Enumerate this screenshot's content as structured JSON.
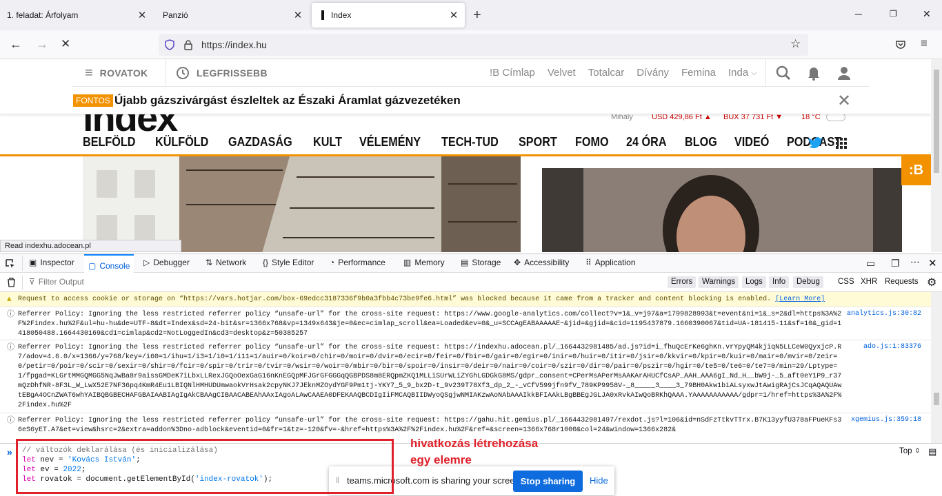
{
  "tabs": [
    {
      "title": "1. feladat: Árfolyam"
    },
    {
      "title": "Panzió"
    },
    {
      "title": "Index"
    }
  ],
  "nav": {
    "url": "https://index.hu"
  },
  "site": {
    "rovatok": "ROVATOK",
    "legfrissebb": "LEGFRISSEBB",
    "sites": [
      "!B Címlap",
      "Velvet",
      "Totalcar",
      "Dívány",
      "Femina",
      "Inda"
    ],
    "fontos_badge": "FONTOS",
    "headline": "Újabb gázszivárgást észleltek az Északi Áramlat gázvezetéken",
    "logo": "index",
    "ticker": {
      "name": "Mihály",
      "usd": "USD 429,86 Ft",
      "bux": "BUX 37 731 Ft",
      "temp": "18 °C"
    },
    "categories": [
      "BELFÖLD",
      "KÜLFÖLD",
      "GAZDASÁG",
      "KULT",
      "VÉLEMÉNY",
      "TECH-TUD",
      "SPORT",
      "FOMO",
      "24 ÓRA",
      "BLOG",
      "VIDEÓ",
      "PODCAST"
    ],
    "badge": ":B",
    "status": "Read indexhu.adocean.pl",
    "accent": "#f39200"
  },
  "devtools": {
    "tools": [
      "Inspector",
      "Console",
      "Debugger",
      "Network",
      "Style Editor",
      "Performance",
      "Memory",
      "Storage",
      "Accessibility",
      "Application"
    ],
    "filter_placeholder": "Filter Output",
    "levels": [
      "Errors",
      "Warnings",
      "Logs",
      "Info",
      "Debug"
    ],
    "extra": [
      "CSS",
      "XHR",
      "Requests"
    ],
    "messages": [
      {
        "type": "warning",
        "text": "Request to access cookie or storage on “https://vars.hotjar.com/box-69edcc3187336f9b0a3fbb4c73be9fe6.html” was blocked because it came from a tracker and content blocking is enabled.",
        "link": "[Learn More]",
        "source": ""
      },
      {
        "type": "info",
        "text": "Referrer Policy: Ignoring the less restricted referrer policy “unsafe-url” for the cross-site request: https://www.google-analytics.com/collect?v=1&_v=j97&a=1799828993&t=event&ni=1&_s=2&dl=https%3A%2F%2Findex.hu%2F&ul=hu-hu&de=UTF-8&dt=Index&sd=24-bit&sr=1366x768&vp=1349x643&je=0&ec=cimlap_scroll&ea=Loaded&ev=0&_u=SCCAgEABAAAAAE~&jid=&gjid=&cid=1195437879.1660390067&tid=UA-181415-11&sf=10&_gid=1418050488.1664430169&cd1=cimlap&cd2=NotLoggedIn&cd3=desktop&z=50385257",
        "source": "analytics.js:30:82"
      },
      {
        "type": "info",
        "text": "Referrer Policy: Ignoring the less restricted referrer policy “unsafe-url” for the cross-site request: https://indexhu.adocean.pl/_1664432981485/ad.js?id=i_fhuQcErKe6ghKn.vrYpyQM4kjiqN5LLCeW0QyxjcP.R7/adov=4.6.0/x=1366/y=768/key=/i60=1/ihu=1/i3=1/i0=1/i11=1/auir=0/koir=0/chir=0/moir=0/dvir=0/ecir=0/feir=0/fbir=0/gair=0/egir=0/inir=0/huir=0/itir=0/jsir=0/kkvir=0/kpir=0/kuir=0/mair=0/mvir=0/zeir=0/petir=0/poir=0/scir=0/sexir=0/shir=0/fcir=0/spir=0/trir=0/tvir=0/wsir=0/woir=0/mbir=0/bir=0/spoir=0/insir=0/deir=0/nair=0/coir=0/szir=0/dir=0/pair=0/pszir=0/hgir=0/te5=0/te6=0/te7=0/min=29/Lptype=1/fpgad=KLGrtMMGQMGG5NqJwBa8r9aissGMDeK7iLbxLLRexJGQoOexGaG16nKnEGQpMFJGrGFGGGqQGBPDS8m8ERQpmZKQ1MLLiSUrWLiZYGhLGDGkG8MS/gdpr_consent=CPerMsAPerMsAAKArAHUCfCsAP_AAH_AAA6gI_Nd_H__bW9j-_5_aft0eY1P9_r37mQzDhfNR-8F3L_W_LwX52E7NF36pq4KmR4Eu1LBIQNlHMHUDUmwaokVrHsak2cpyNKJ7JEknMZOydYGF9Pm1tj-YKY7_5_9_bx2D-t_9v239T78Xf3_dp_2_-_vCfV599jfn9fV_789KP9958V-_8_____3____3_79BH0Akw1biALsyxwJtAwigRAjCsJCqAQAQUAwtEBgA4OCnZWAT6whYAIBQBGBECHAFGBAIAABIAgIgAkCBAAgCIBAACABEAhAAxIAgoALAwCAAEA0DFEKAAQBCDIgIiFMCAQBIIDWyoQSgjwNMIAKzwAoNAbAAAIkkBFIAAkLBgBBEgJGLJA0xRvkAIwQoBRKhQAAA.YAAAAAAAAAAA/gdpr=1/href=https%3A%2F%2Findex.hu%2F",
        "source": "ado.js:1:83376"
      },
      {
        "type": "info",
        "text": "Referrer Policy: Ignoring the less restricted referrer policy “unsafe-url” for the cross-site request: https://gahu.hit.gemius.pl/_1664432981497/rexdot.js?l=106&id=nSdFzTtkvTTrx.B7K13yyfU378aFPueKFs36eS6yET.A7&et=view&hsrc=2&extra=addon%3Dno-adblock&eventid=0&fr=1&tz=-120&fv=-&href=https%3A%2F%2Findex.hu%2F&ref=&screen=1366x768r1000&col=24&window=1366x282&",
        "source": "xgemius.js:359:18"
      }
    ],
    "input_lines": [
      {
        "comment": "// változók deklarálása (és inicializálása)"
      },
      {
        "kw": "let",
        "rest": " nev = ",
        "str": "'Kovács István'",
        "end": ";"
      },
      {
        "kw": "let",
        "rest": " ev = ",
        "num": "2022",
        "end": ";"
      },
      {
        "kw": "let",
        "rest": " rovatok = document.getElementById(",
        "str": "'index-rovatok'",
        "end": ");"
      }
    ],
    "top_selector": "Top"
  },
  "share_bar": {
    "text": "teams.microsoft.com is sharing your screen.",
    "stop": "Stop sharing",
    "hide": "Hide"
  },
  "annotation": {
    "line1": "hivatkozás létrehozása",
    "line2": "egy elemre",
    "color": "#e0202a"
  }
}
